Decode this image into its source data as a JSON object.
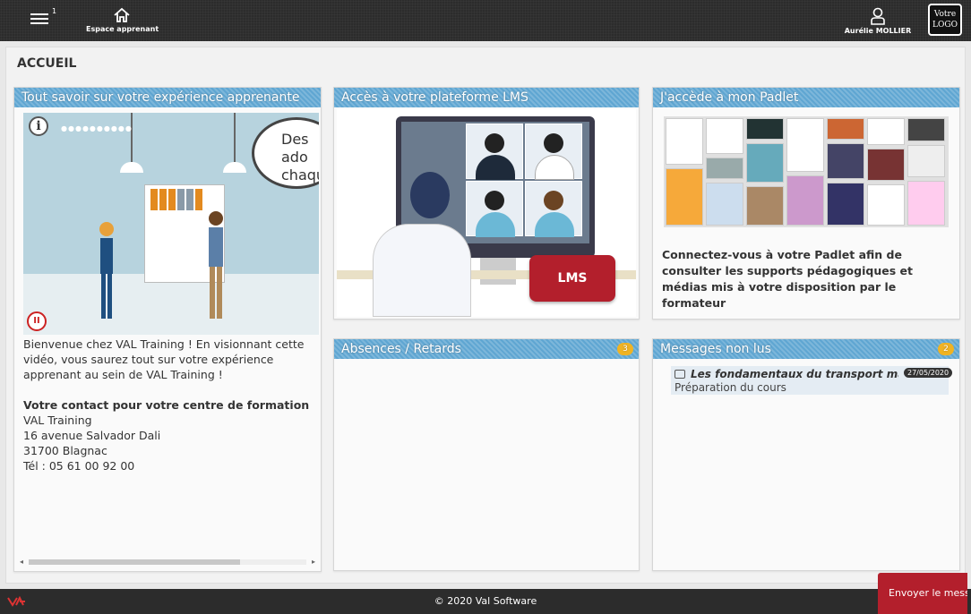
{
  "header": {
    "menu_badge": "1",
    "home_label": "Espace apprenant",
    "user_name": "Aurélie MOLLIER",
    "logo_text": "Votre LOGO"
  },
  "page": {
    "title": "ACCUEIL"
  },
  "cards": {
    "experience": {
      "title": "Tout savoir sur votre expérience apprenante",
      "video_bubble": "Des ado chaqu",
      "intro": "Bienvenue chez VAL Training ! En visionnant cette vidéo, vous saurez tout sur votre expérience apprenant au sein de VAL Training !",
      "contact_heading": "Votre contact pour votre centre de formation",
      "contact_name": "VAL Training",
      "contact_street": "16 avenue Salvador Dali",
      "contact_city": "31700 Blagnac",
      "contact_phone": "Tél : 05 61 00 92 00"
    },
    "lms": {
      "title": "Accès à votre plateforme LMS",
      "button": "LMS"
    },
    "padlet": {
      "title": "J'accède à mon Padlet",
      "text": "Connectez-vous à votre Padlet afin de consulter les supports pédagogiques et médias mis à votre disposition par le formateur"
    },
    "absences": {
      "title": "Absences / Retards",
      "count": "3"
    },
    "messages": {
      "title": "Messages non lus",
      "count": "2",
      "items": [
        {
          "title": "Les fondamentaux du transport marit",
          "date": "27/05/2020",
          "subtitle": "Préparation du cours"
        }
      ]
    }
  },
  "footer": {
    "copyright": "© 2020 Val Software"
  },
  "send_button": "Envoyer le messa",
  "colors": {
    "header_bg": "#2c2c2c",
    "card_head": "#5fa6d2",
    "accent_red": "#b31f2c",
    "badge": "#f0b323"
  }
}
